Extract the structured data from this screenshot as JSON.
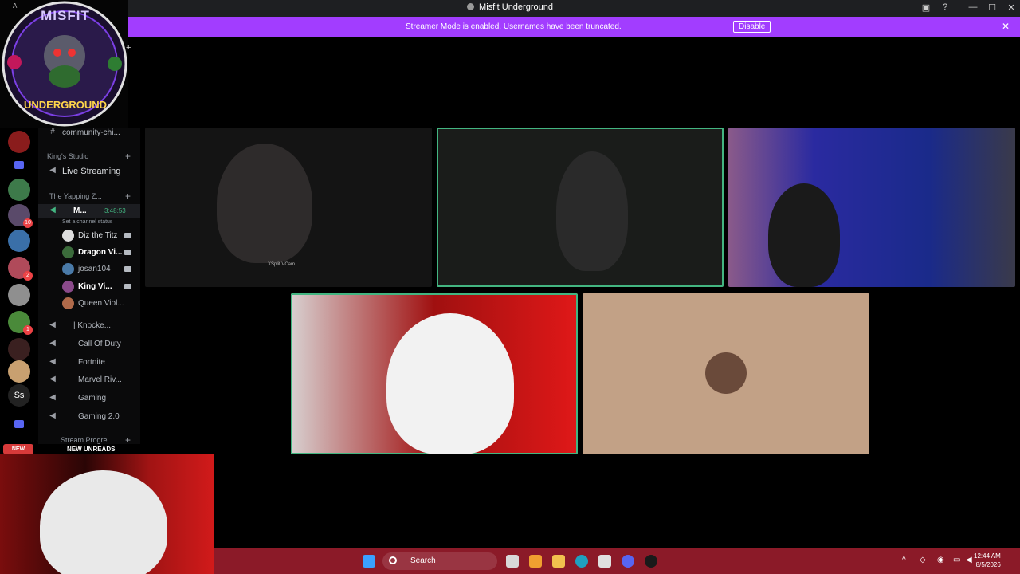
{
  "window": {
    "title": "Misfit Underground",
    "controls": {
      "minimize": "—",
      "maximize": "☐",
      "close": "✕"
    }
  },
  "banner": {
    "message": "Streamer Mode is enabled. Usernames have been truncated.",
    "disable_label": "Disable",
    "close": "✕",
    "color": "#a23dff"
  },
  "logo": {
    "top_text": "MISFIT",
    "bottom_text": "UNDERGROUND",
    "corner_text": "AI",
    "plus": "+"
  },
  "sidebar": {
    "partial_channel": "community-chi...",
    "category_1": "King's Studio",
    "live_streaming": "Live Streaming",
    "category_2": "The Yapping Z...",
    "active_voice": {
      "name": "M...",
      "timer": "3:48:53",
      "status": "Set a channel status"
    },
    "members": [
      {
        "name": "Diz the Titz",
        "color": "#dbdee1"
      },
      {
        "name": "Dragon Vi...",
        "color": "#ffffff"
      },
      {
        "name": "josan104",
        "color": "#b5bac1"
      },
      {
        "name": "King Vi...",
        "color": "#ffffff"
      },
      {
        "name": "Queen Viol...",
        "color": "#b5bac1"
      }
    ],
    "voice_channels": [
      {
        "name": "| Knocke..."
      },
      {
        "name": "Call Of Duty"
      },
      {
        "name": "Fortnite"
      },
      {
        "name": "Marvel Riv..."
      },
      {
        "name": "Gaming"
      },
      {
        "name": "Gaming 2.0"
      }
    ],
    "category_3": "Stream Progre...",
    "new_badge": "NEW",
    "new_unreads": "NEW UNREADS"
  },
  "servers": [
    {
      "badge": ""
    },
    {
      "badge": ""
    },
    {
      "badge": "10"
    },
    {
      "badge": ""
    },
    {
      "badge": "2"
    },
    {
      "badge": ""
    },
    {
      "badge": "1"
    },
    {
      "badge": ""
    },
    {
      "badge": ""
    },
    {
      "badge": "Ss"
    }
  ],
  "stage": {
    "watermark": "XSplit VCam"
  },
  "taskbar": {
    "search_label": "Search",
    "time": "12:44 AM",
    "date": "8/5/2026",
    "tray_chevron": "^"
  }
}
